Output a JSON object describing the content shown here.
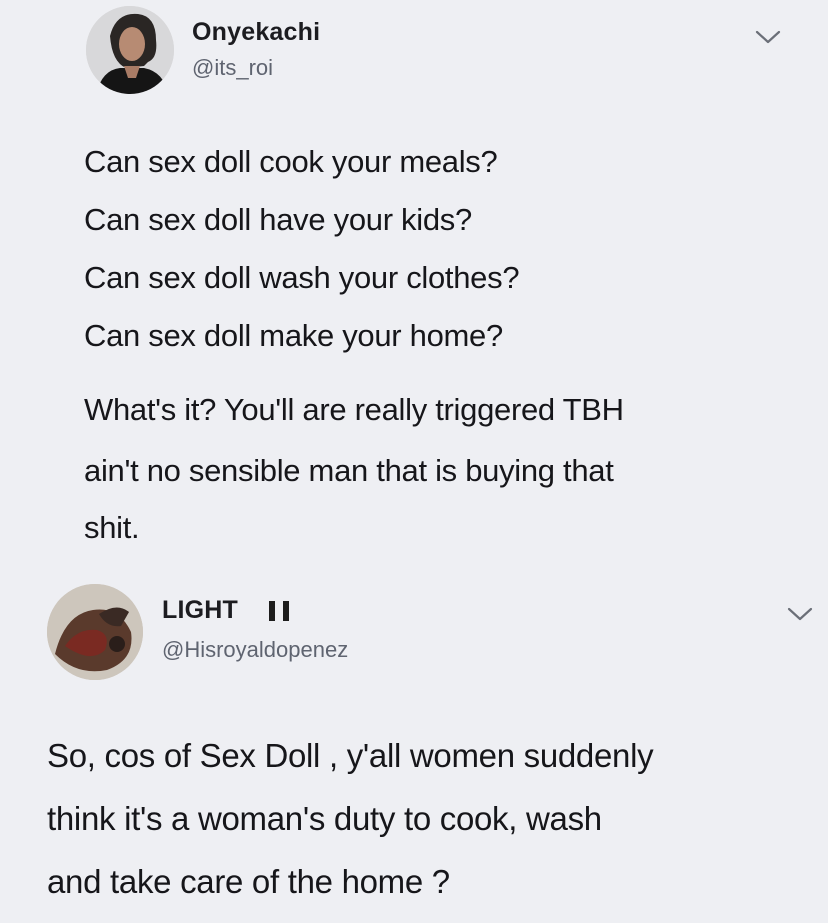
{
  "tweets": [
    {
      "author": "Onyekachi",
      "handle": "@its_roi",
      "lines": [
        "Can sex doll cook your meals?",
        "Can sex doll have your kids?",
        "Can sex doll wash your clothes?",
        "Can sex doll make your home?",
        "What's it? You'll are really triggered TBH",
        "ain't no sensible man that is buying that",
        "shit."
      ]
    },
    {
      "author": "LIGHT",
      "handle": "@Hisroyaldopenez",
      "flag_icon": "nigeria-flag-icon",
      "lines": [
        "So, cos of Sex Doll , y'all women suddenly",
        "think it's a woman's duty to cook, wash",
        "and take care of the home ?"
      ]
    }
  ],
  "colors": {
    "background": "#eeeff3",
    "text": "#16161a",
    "handle": "#5f6470"
  }
}
